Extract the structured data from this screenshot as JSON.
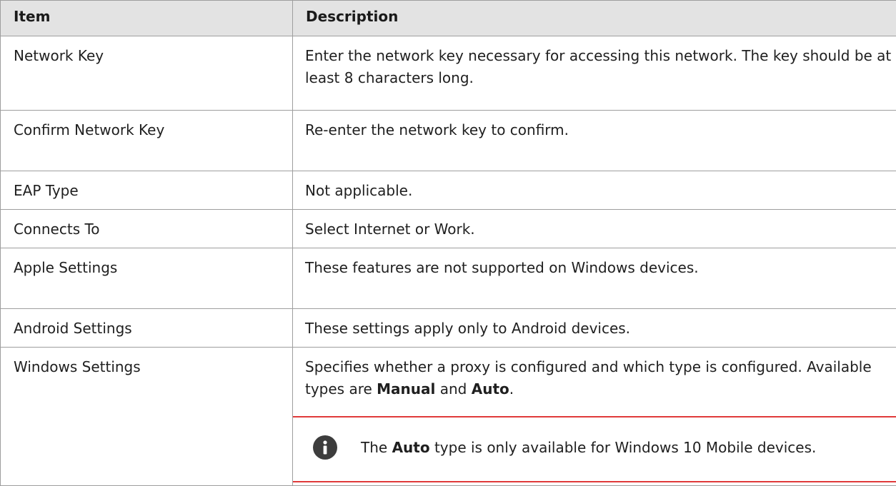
{
  "table": {
    "header": {
      "item": "Item",
      "description": "Description"
    },
    "rows": [
      {
        "item": "Network Key",
        "description": "Enter the network key necessary for accessing this network. The key should be at least 8 characters long."
      },
      {
        "item": "Confirm Network Key",
        "description": "Re-enter the network key to confirm."
      },
      {
        "item": "EAP Type",
        "description": "Not applicable."
      },
      {
        "item": "Connects To",
        "description": "Select Internet or Work."
      },
      {
        "item": "Apple Settings",
        "description": "These features are not supported on Windows devices."
      },
      {
        "item": "Android Settings",
        "description": "These settings apply only to Android devices."
      },
      {
        "item": "Windows Settings",
        "description_prefix": "Specifies whether a proxy is configured and which type is configured. Available types are ",
        "description_bold_1": "Manual",
        "description_middle": " and ",
        "description_bold_2": "Auto",
        "description_suffix": ".",
        "note": {
          "icon": "info-icon",
          "text_prefix": "The ",
          "text_bold": "Auto",
          "text_suffix": " type is only available for Windows 10 Mobile devices."
        }
      }
    ]
  },
  "colors": {
    "header_background": "#e3e3e3",
    "border": "#9e9e9e",
    "note_border": "#e03a3a",
    "icon_background": "#3d3d3d"
  }
}
